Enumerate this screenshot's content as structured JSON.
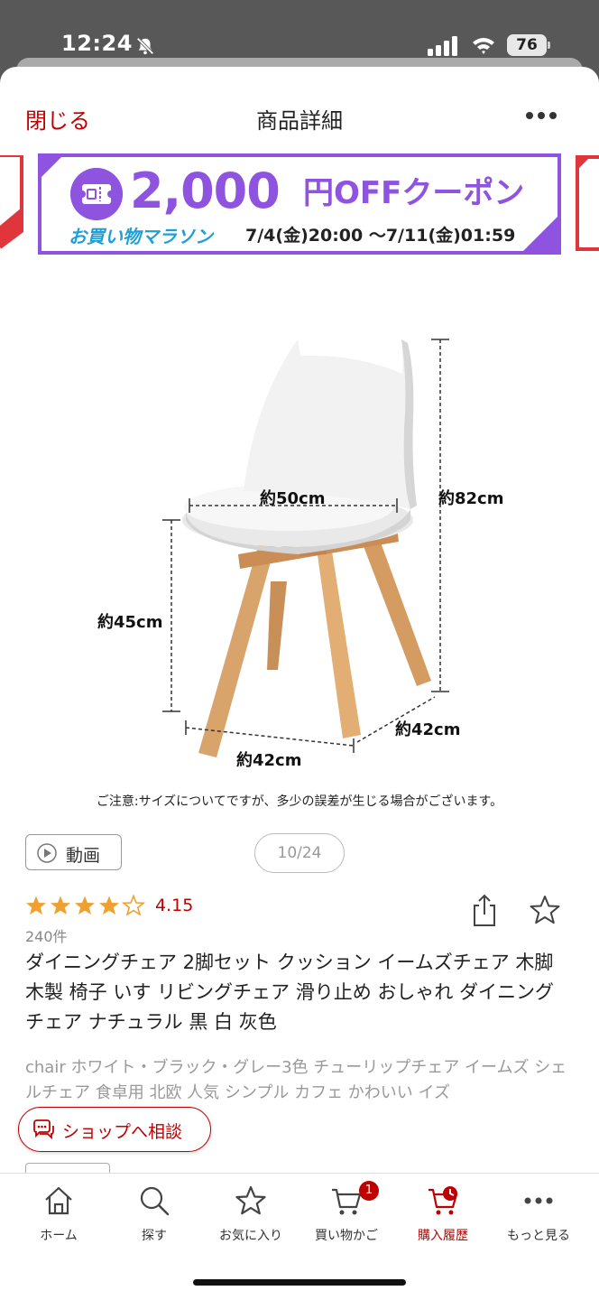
{
  "status_bar": {
    "time": "12:24",
    "battery": "76"
  },
  "header": {
    "close_label": "閉じる",
    "title": "商品詳細"
  },
  "banner": {
    "amount": "2,000",
    "suffix": "円OFFクーポン",
    "event_name": "お買い物マラソン",
    "date_range": "7/4(金)20:00 〜7/11(金)01:59",
    "accent_color": "#8e54e0"
  },
  "product_image": {
    "dimensions": {
      "seat_width": "約50cm",
      "height": "約82cm",
      "seat_height": "約45cm",
      "depth": "約42cm",
      "width": "約42cm"
    },
    "caption": "ご注意:サイズについてですが、多少の誤差が生じる場合がございます。"
  },
  "media": {
    "video_label": "動画",
    "page_indicator": "10/24"
  },
  "rating": {
    "score": "4.15",
    "stars_value": 4.15,
    "stars_max": 5,
    "review_count": "240件"
  },
  "product": {
    "title": "ダイニングチェア 2脚セット クッション イームズチェア 木脚 木製 椅子 いす リビングチェア 滑り止め おしゃれ ダイニング チェア ナチュラル 黒 白 灰色",
    "description": "chair ホワイト・ブラック・グレー3色 チューリップチェア イームズ シェルチェア 食卓用 北欧 人気 シンプル カフェ かわいい イズ"
  },
  "consult_label": "ショップへ相談",
  "tab_bar": {
    "items": [
      {
        "label": "ホーム",
        "icon": "home-icon"
      },
      {
        "label": "探す",
        "icon": "search-icon"
      },
      {
        "label": "お気に入り",
        "icon": "star-icon"
      },
      {
        "label": "買い物かご",
        "icon": "cart-icon"
      },
      {
        "label": "購入履歴",
        "icon": "history-icon"
      },
      {
        "label": "もっと見る",
        "icon": "more-icon"
      }
    ],
    "cart_badge": "1",
    "active": "購入履歴"
  },
  "colors": {
    "brand_red": "#bf0000",
    "rating_star": "#f0a030"
  }
}
